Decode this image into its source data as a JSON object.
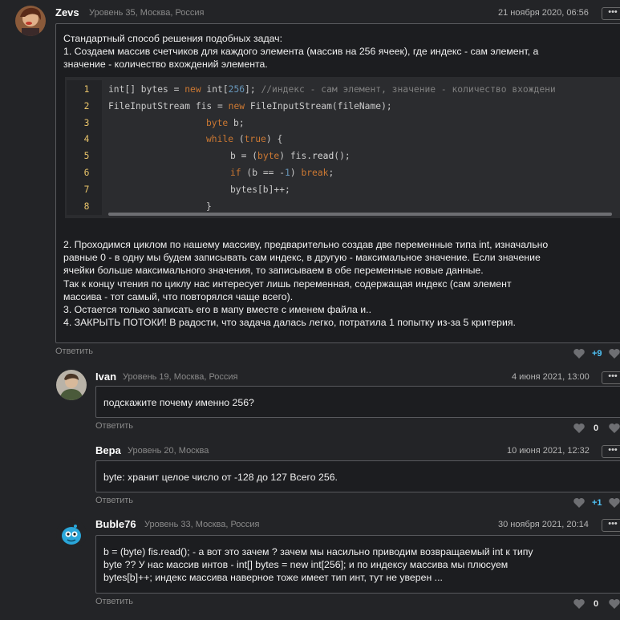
{
  "colors": {
    "background": "#232427",
    "box_border": "#58595d",
    "code_bg": "#2b2c2f",
    "keyword": "#cc7832",
    "number": "#6897bb",
    "comment": "#808080",
    "line_number": "#e9c46a",
    "positive_score": "#4fc3f7"
  },
  "comments": [
    {
      "author": "Zevs",
      "meta": "Уровень 35, Москва, Россия",
      "date": "21 ноября 2020, 06:56",
      "more": "•••",
      "intro": [
        "Стандартный способ решения подобных задач:",
        "1. Создаем массив счетчиков для каждого элемента (массив на 256 ячеек), где индекс - сам элемент, а",
        "значение - количество вхождений элемента."
      ],
      "code_lines": [
        "1",
        "2",
        "3",
        "4",
        "5",
        "6",
        "7",
        "8"
      ],
      "code": {
        "l1_a": "int[] bytes = ",
        "l1_kw": "new",
        "l1_b": " int[",
        "l1_n": "256",
        "l1_c": "]; ",
        "l1_cm": "//индекс - сам элемент, значение - количество вхождени",
        "l2_a": "FileInputStream fis = ",
        "l2_kw": "new",
        "l2_b": " FileInputStream(fileName);",
        "l3_kw": "byte",
        "l3_b": " b;",
        "l4_kw": "while",
        "l4_b": " (",
        "l4_kw2": "true",
        "l4_c": ") {",
        "l5_a": "b = (",
        "l5_kw": "byte",
        "l5_b": ") fis.",
        "l5_fn": "read",
        "l5_c": "();",
        "l6_kw": "if",
        "l6_a": " (b == -",
        "l6_n": "1",
        "l6_b": ") ",
        "l6_kw2": "break",
        "l6_c": ";",
        "l7_a": "bytes[b]++;",
        "l8_a": "}"
      },
      "rest": [
        "2. Проходимся циклом по нашему массиву, предварительно создав две переменные типа int, изначально",
        "равные 0 - в одну мы будем записывать сам индекс, в другую - максимальное значение. Если значение",
        "ячейки больше максимального значения, то записываем в обе переменные новые данные.",
        "Так к концу чтения по циклу нас интересует лишь переменная, содержащая индекс (сам элемент",
        "массива - тот самый, что повторялся чаще всего).",
        "3. Остается только записать его в мапу вместе с именем файла и..",
        "4. ЗАКРЫТЬ ПОТОКИ! В радости, что задача далась легко, потратила 1 попытку из-за 5 критерия."
      ],
      "reply": "Ответить",
      "score": "+9"
    },
    {
      "author": "Ivan",
      "meta": "Уровень 19, Москва, Россия",
      "date": "4 июня 2021, 13:00",
      "more": "•••",
      "text": [
        "подскажите почему именно 256?"
      ],
      "reply": "Ответить",
      "score": "0"
    },
    {
      "author": "Вера",
      "meta": "Уровень 20, Москва",
      "date": "10 июня 2021, 12:32",
      "more": "•••",
      "text": [
        "byte: хранит целое число от -128 до 127  Всего 256."
      ],
      "reply": "Ответить",
      "score": "+1"
    },
    {
      "author": "Buble76",
      "meta": "Уровень 33, Москва, Россия",
      "date": "30 ноября 2021, 20:14",
      "more": "•••",
      "text": [
        "b = (byte) fis.read(); - а вот это зачем ? зачем мы насильно приводим возвращаемый int к типу",
        "byte  ?? У нас массив интов - int[] bytes = new int[256]; и по индексу массива мы плюсуем",
        "bytes[b]++; индекс массива наверное тоже имеет тип инт, тут не уверен ..."
      ],
      "reply": "Ответить",
      "score": "0"
    }
  ]
}
